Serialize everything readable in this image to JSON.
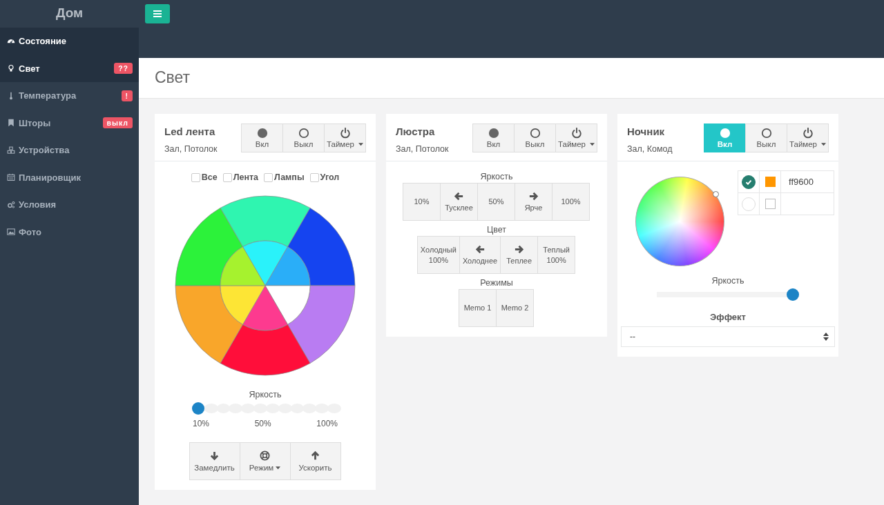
{
  "brand": "Дом",
  "sidebar": {
    "items": [
      {
        "label": "Состояние",
        "selected": true
      },
      {
        "label": "Свет",
        "selected": true,
        "badge": "??"
      },
      {
        "label": "Температура",
        "selected": false,
        "badge": "!"
      },
      {
        "label": "Шторы",
        "selected": false,
        "badge": "выкл"
      },
      {
        "label": "Устройства",
        "selected": false
      },
      {
        "label": "Планировщик",
        "selected": false
      },
      {
        "label": "Условия",
        "selected": false
      },
      {
        "label": "Фото",
        "selected": false
      }
    ]
  },
  "page_title": "Свет",
  "cards": [
    {
      "kind": "led",
      "title": "Led лента",
      "subtitle": "Зал, Потолок",
      "power_buttons": [
        {
          "kind": "dot",
          "label": "Вкл",
          "selected": false
        },
        {
          "kind": "ring",
          "label": "Выкл",
          "selected": false
        },
        {
          "kind": "power",
          "label": "Таймер",
          "selected": false
        }
      ],
      "checkboxes": [
        {
          "label": "Все",
          "checked": false
        },
        {
          "label": "Лента",
          "checked": false
        },
        {
          "label": "Лампы",
          "checked": false
        },
        {
          "label": "Угол",
          "checked": false
        }
      ],
      "outer_segments": [
        {
          "color": "#2ff5b0"
        },
        {
          "color": "#1544f0"
        },
        {
          "color": "#b97cf2"
        },
        {
          "color": "#ff0e3a"
        },
        {
          "color": "#f9a62a"
        },
        {
          "color": "#2cf23a"
        }
      ],
      "inner_segments": [
        {
          "color": "#2af2fa"
        },
        {
          "color": "#2aaef8"
        },
        {
          "color": "#ffffff"
        },
        {
          "color": "#fd3a8f"
        },
        {
          "color": "#fde535"
        },
        {
          "color": "#a6f22e"
        }
      ],
      "slider_label": "Яркость",
      "level": 0,
      "ticks": [
        "10%",
        "50%",
        "100%"
      ],
      "bottom_buttons": [
        {
          "kind": "down",
          "label": "Замедлить"
        },
        {
          "kind": "lifebuoy",
          "label": "Режим",
          "dropdown": true
        },
        {
          "kind": "up",
          "label": "Ускорить"
        }
      ]
    },
    {
      "kind": "lamp",
      "title": "Люстра",
      "subtitle": "Зал, Потолок",
      "power_buttons": [
        {
          "kind": "dot",
          "label": "Вкл",
          "selected": false
        },
        {
          "kind": "ring",
          "label": "Выкл",
          "selected": false
        },
        {
          "kind": "power",
          "label": "Таймер",
          "selected": false
        }
      ],
      "groups": [
        {
          "label": "Яркость",
          "buttons": [
            {
              "kind": "plain",
              "label": "10%"
            },
            {
              "kind": "left",
              "label": "Тусклее"
            },
            {
              "kind": "plain",
              "label": "50%"
            },
            {
              "kind": "right",
              "label": "Ярче"
            },
            {
              "kind": "plain",
              "label": "100%"
            }
          ]
        },
        {
          "label": "Цвет",
          "buttons": [
            {
              "kind": "plain",
              "label": "Холодный\n100%"
            },
            {
              "kind": "left",
              "label": "Холоднее"
            },
            {
              "kind": "right",
              "label": "Теплее"
            },
            {
              "kind": "plain",
              "label": "Теплый\n100%"
            }
          ]
        },
        {
          "label": "Режимы",
          "buttons": [
            {
              "kind": "plain",
              "label": "Memo 1"
            },
            {
              "kind": "plain",
              "label": "Memo 2"
            }
          ]
        }
      ]
    },
    {
      "kind": "rgb",
      "title": "Ночник",
      "subtitle": "Зал, Комод",
      "power_buttons": [
        {
          "kind": "dot",
          "label": "Вкл",
          "selected": true
        },
        {
          "kind": "ring",
          "label": "Выкл",
          "selected": false
        },
        {
          "kind": "power",
          "label": "Таймер",
          "selected": false
        }
      ],
      "presets": [
        {
          "selected": true,
          "color": "#ff9600",
          "value": "ff9600"
        },
        {
          "selected": false
        }
      ],
      "slider_label": "Яркость",
      "level": 1,
      "effect_label": "Эффект",
      "effect_value": "--"
    }
  ]
}
